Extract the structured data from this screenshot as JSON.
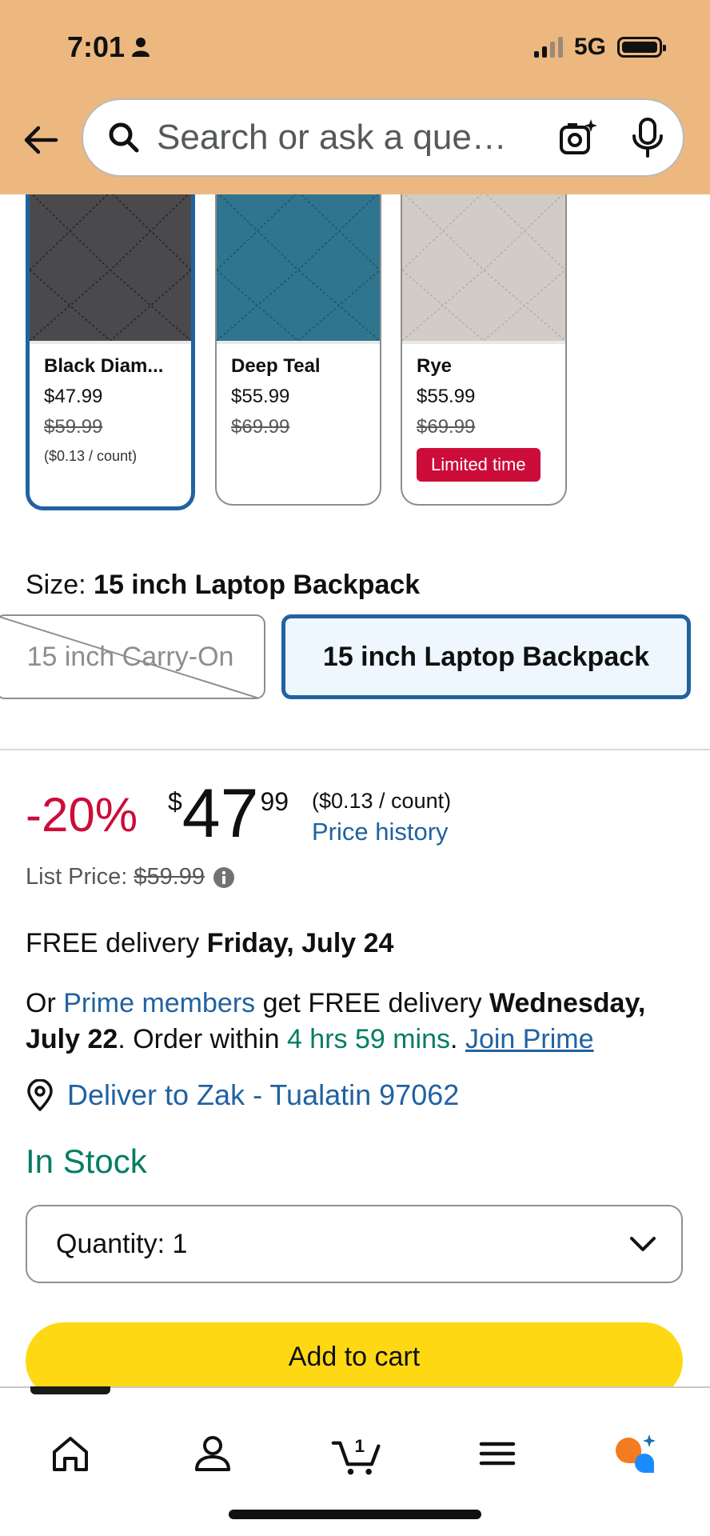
{
  "status_bar": {
    "time": "7:01",
    "network": "5G"
  },
  "search": {
    "placeholder": "Search or ask a question",
    "placeholder_display": "Search or ask a que…"
  },
  "swatches": [
    {
      "name": "Black Diam...",
      "price": "$47.99",
      "list_price": "$59.99",
      "unit_price": "($0.13 / count)",
      "color": "#4a4a4c",
      "selected": true
    },
    {
      "name": "Deep Teal",
      "price": "$55.99",
      "list_price": "$69.99",
      "color": "#2f7590",
      "selected": false
    },
    {
      "name": "Rye",
      "price": "$55.99",
      "list_price": "$69.99",
      "badge": "Limited time",
      "color": "#d2ccc7",
      "selected": false
    }
  ],
  "size": {
    "label": "Size: ",
    "selected": "15 inch Laptop Backpack",
    "options": [
      "15 inch Carry-On",
      "15 inch Laptop Backpack"
    ]
  },
  "price": {
    "discount": "-20%",
    "symbol": "$",
    "whole": "47",
    "fraction": "99",
    "unit_price": "($0.13 / count)",
    "history_link": "Price history",
    "list_price_label": "List Price:",
    "list_price_value": "$59.99"
  },
  "delivery": {
    "prefix": "FREE delivery ",
    "date": "Friday, July 24"
  },
  "prime": {
    "or": "Or ",
    "members": "Prime members",
    "get": " get FREE delivery ",
    "date": "Wednesday, July 22",
    "order_within": ". Order within ",
    "countdown": "4 hrs 59 mins",
    "period": ". ",
    "join": "Join Prime"
  },
  "deliver_to": "Deliver to Zak - Tualatin 97062",
  "stock": "In Stock",
  "quantity": {
    "label": "Quantity:",
    "value": "1"
  },
  "add_to_cart": "Add to cart",
  "cart_count": "1",
  "colors": {
    "header": "#edb880",
    "link": "#2162a1",
    "deal": "#cc0c39",
    "stock": "#067d62",
    "cart_button": "#ffd814",
    "selected_border": "#2162a1"
  }
}
